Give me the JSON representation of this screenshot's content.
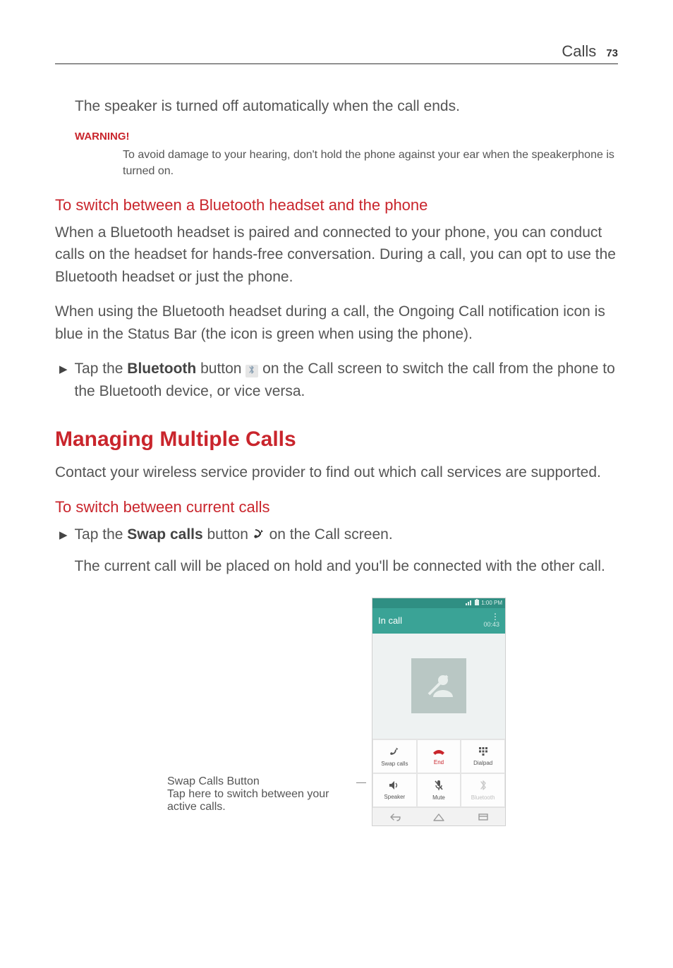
{
  "running_head": {
    "section": "Calls",
    "page_number": "73"
  },
  "speaker_off_text": "The speaker is turned off automatically when the call ends.",
  "warning": {
    "label": "WARNING!",
    "text": "To avoid damage to your hearing, don't hold the phone against your ear when the speakerphone is turned on."
  },
  "bluetooth_switch": {
    "heading": "To switch between a Bluetooth headset and the phone",
    "p1": "When a Bluetooth headset is paired and connected to your phone, you can conduct calls on the headset for hands-free conversation. During a call, you can opt to use the Bluetooth headset or just the phone.",
    "p2": "When using the Bluetooth headset during a call, the Ongoing Call notification icon is blue in the Status Bar (the icon is green when using the phone).",
    "bullet_pre": "Tap the ",
    "bullet_bold": "Bluetooth",
    "bullet_mid": " button ",
    "bullet_post": " on the Call screen to switch the call from the phone to the Bluetooth device, or vice versa."
  },
  "managing": {
    "h2": "Managing Multiple Calls",
    "intro": "Contact your wireless service provider to find out which call services are supported."
  },
  "switch_calls": {
    "heading": "To switch between current calls",
    "bullet_pre": "Tap the ",
    "bullet_bold": "Swap calls",
    "bullet_mid": " button ",
    "bullet_post": " on the Call screen.",
    "result_p": "The current call will be placed on hold and you'll be connected with the other call."
  },
  "callout": {
    "title": "Swap Calls Button",
    "body": "Tap here to switch between your active calls."
  },
  "phone": {
    "status_time": "1:00 PM",
    "header_title": "In call",
    "timer": "00:43",
    "buttons": {
      "swap": "Swap calls",
      "end": "End",
      "dialpad": "Dialpad",
      "speaker": "Speaker",
      "mute": "Mute",
      "bluetooth": "Bluetooth"
    }
  },
  "icons": {
    "bluetooth_inline": "bluetooth-icon",
    "swap_inline": "swap-calls-icon"
  }
}
